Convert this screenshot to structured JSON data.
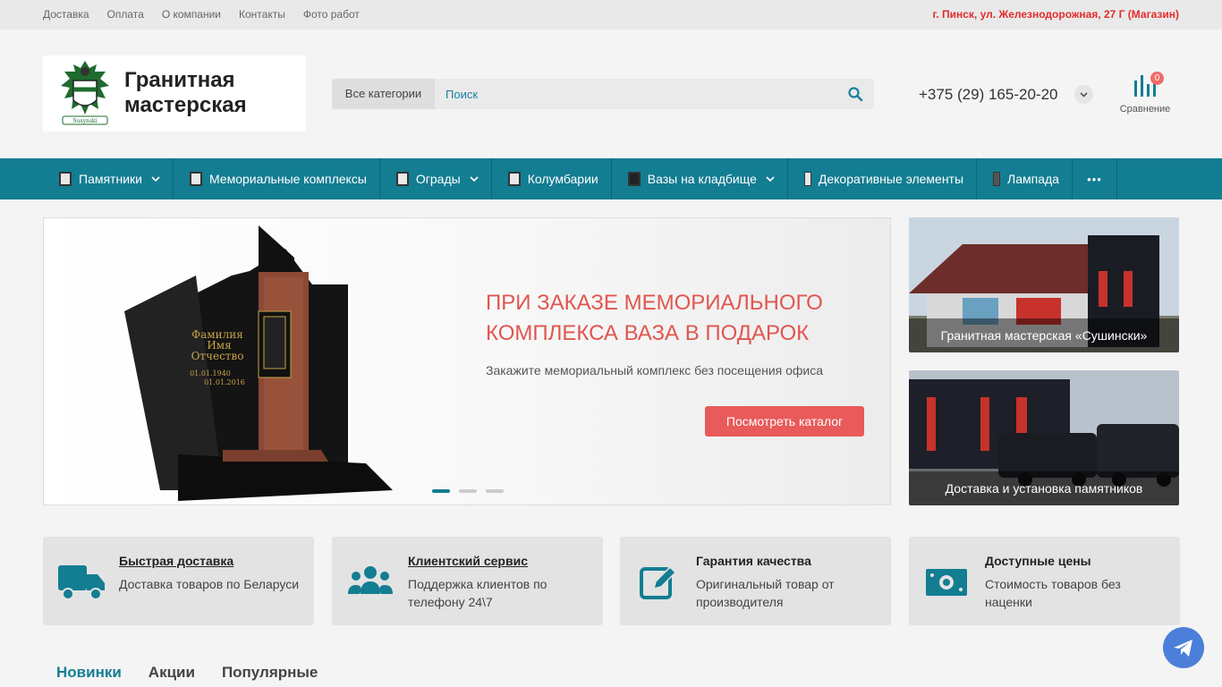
{
  "topbar": {
    "links": [
      "Доставка",
      "Оплата",
      "О компании",
      "Контакты",
      "Фото работ"
    ],
    "address": "г. Пинск, ул. Железнодорожная, 27 Г (Магазин)"
  },
  "logo": {
    "line1": "Гранитная",
    "line2": "мастерская",
    "emblem_text": "Susynski"
  },
  "search": {
    "category": "Все категории",
    "placeholder": "Поиск",
    "icon": "search-icon"
  },
  "contact": {
    "phone": "+375 (29) 165-20-20"
  },
  "compare": {
    "label": "Сравнение",
    "count": "0"
  },
  "nav": {
    "items": [
      {
        "label": "Памятники",
        "dropdown": true
      },
      {
        "label": "Мемориальные комплексы",
        "dropdown": false
      },
      {
        "label": "Ограды",
        "dropdown": true
      },
      {
        "label": "Колумбарии",
        "dropdown": false
      },
      {
        "label": "Вазы на кладбище",
        "dropdown": true
      },
      {
        "label": "Декоративные элементы",
        "dropdown": false
      },
      {
        "label": "Лампада",
        "dropdown": false
      }
    ],
    "more": "•••"
  },
  "hero": {
    "title": "При заказе мемориального комплекса ваза в подарок",
    "subtitle": "Закажите мемориальный комплекс без посещения офиса",
    "button": "Посмотреть каталог",
    "engraving": {
      "l1": "Фамилия",
      "l2": "Имя",
      "l3": "Отчество",
      "d1": "01.01.1940",
      "d2": "01.01.2016"
    },
    "slides": 3,
    "active_slide": 1
  },
  "banners": [
    {
      "caption": "Гранитная мастерская «Сушински»"
    },
    {
      "caption": "Доставка и установка памятников"
    }
  ],
  "features": [
    {
      "title": "Быстрая доставка",
      "text": "Доставка товаров по Беларуси",
      "icon": "truck-icon",
      "link": true
    },
    {
      "title": "Клиентский сервис",
      "text": "Поддержка клиентов по телефону 24\\7",
      "icon": "users-icon",
      "link": true
    },
    {
      "title": "Гарантия качества",
      "text": "Оригинальный товар от производителя",
      "icon": "edit-icon",
      "link": false
    },
    {
      "title": "Доступные цены",
      "text": "Стоимость товаров без наценки",
      "icon": "money-icon",
      "link": false
    }
  ],
  "tabs": [
    "Новинки",
    "Акции",
    "Популярные"
  ],
  "colors": {
    "primary": "#137d92",
    "accent": "#e95a5a",
    "address": "#e52b2b"
  }
}
